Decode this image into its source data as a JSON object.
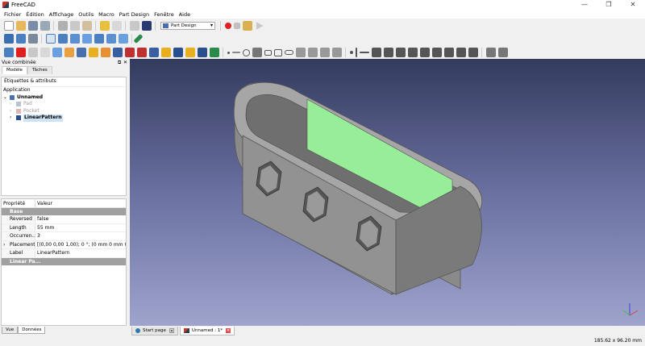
{
  "window": {
    "title": "FreeCAD",
    "min": "—",
    "max": "❐",
    "close": "✕"
  },
  "menu": [
    "Fichier",
    "Édition",
    "Affichage",
    "Outils",
    "Macro",
    "Part Design",
    "Fenêtre",
    "Aide"
  ],
  "toolbar": {
    "workbench": "Part Design"
  },
  "combo": {
    "title": "Vue combinée",
    "tabs": [
      "Modèle",
      "Tâches"
    ],
    "tree": {
      "header": "Étiquettes & attributs",
      "section": "Application",
      "items": [
        {
          "label": "Unnamed",
          "bold": true
        },
        {
          "label": "Pad",
          "greyed": true
        },
        {
          "label": "Pocket",
          "greyed": true
        },
        {
          "label": "LinearPattern",
          "bold": true
        }
      ]
    },
    "properties": {
      "col_prop": "Propriété",
      "col_val": "Valeur",
      "group1": "Base",
      "rows": [
        {
          "name": "Reversed",
          "value": "false"
        },
        {
          "name": "Length",
          "value": "55 mm"
        },
        {
          "name": "Occurren...",
          "value": "3"
        },
        {
          "name": "Placement",
          "value": "[(0,00 0,00 1,00); 0 °; (0 mm  0 mm  0 ..."
        },
        {
          "name": "Label",
          "value": "LinearPattern"
        }
      ],
      "group2": "Linear Pa..."
    },
    "bottom_tabs": [
      "Vue",
      "Données"
    ]
  },
  "mdi_tabs": [
    {
      "label": "Start page",
      "active": false
    },
    {
      "label": "Unnamed : 1*",
      "active": true
    }
  ],
  "status": {
    "dimensions": "185.62 x 96.20 mm"
  },
  "colors": {
    "view_top": "#333b5e",
    "view_bottom": "#9ea4cc",
    "face_green": "#98ee98",
    "body_grey": "#8a8a8a"
  }
}
